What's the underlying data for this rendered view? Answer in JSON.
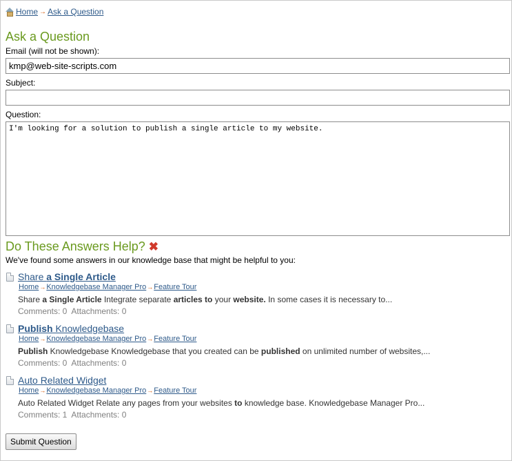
{
  "breadcrumb": {
    "items": [
      "Home",
      "Ask a Question"
    ],
    "separator": "→"
  },
  "page_title": "Ask a Question",
  "form": {
    "email_label": "Email (will not be shown):",
    "email_value": "kmp@web-site-scripts.com",
    "subject_label": "Subject:",
    "subject_value": "",
    "question_label": "Question:",
    "question_value": "I'm looking for a solution to publish a single article to my website."
  },
  "answers": {
    "title": "Do These Answers Help?",
    "intro": "We've found some answers in our knowledge base that might be helpful to you:",
    "results": [
      {
        "title_parts": [
          {
            "text": "Share ",
            "bold": false
          },
          {
            "text": "a Single Article",
            "bold": true
          }
        ],
        "crumbs": [
          "Home",
          "Knowledgebase Manager Pro",
          "Feature Tour"
        ],
        "snippet_parts": [
          {
            "text": "Share ",
            "bold": false
          },
          {
            "text": "a Single Article",
            "bold": true
          },
          {
            "text": " Integrate separate ",
            "bold": false
          },
          {
            "text": "articles to",
            "bold": true
          },
          {
            "text": " your ",
            "bold": false
          },
          {
            "text": "website.",
            "bold": true
          },
          {
            "text": " In some cases it is necessary to...",
            "bold": false
          }
        ],
        "comments": "Comments: 0",
        "attachments": "Attachments: 0"
      },
      {
        "title_parts": [
          {
            "text": "Publish",
            "bold": true
          },
          {
            "text": " Knowledgebase",
            "bold": false
          }
        ],
        "crumbs": [
          "Home",
          "Knowledgebase Manager Pro",
          "Feature Tour"
        ],
        "snippet_parts": [
          {
            "text": "Publish",
            "bold": true
          },
          {
            "text": " Knowledgebase Knowledgebase that you created can be ",
            "bold": false
          },
          {
            "text": "published",
            "bold": true
          },
          {
            "text": " on unlimited number of websites,...",
            "bold": false
          }
        ],
        "comments": "Comments: 0",
        "attachments": "Attachments: 0"
      },
      {
        "title_parts": [
          {
            "text": "Auto Related Widget",
            "bold": false
          }
        ],
        "crumbs": [
          "Home",
          "Knowledgebase Manager Pro",
          "Feature Tour"
        ],
        "snippet_parts": [
          {
            "text": "Auto Related Widget Relate any pages from your websites ",
            "bold": false
          },
          {
            "text": "to",
            "bold": true
          },
          {
            "text": " knowledge base. Knowledgebase Manager Pro...",
            "bold": false
          }
        ],
        "comments": "Comments: 1",
        "attachments": "Attachments: 0"
      }
    ]
  },
  "submit_label": "Submit Question",
  "icons": {
    "home": "home-icon",
    "close": "close-x-icon",
    "document": "document-icon"
  },
  "colors": {
    "heading": "#6a9a1f",
    "link": "#2e5a8a",
    "arrow": "#d35400",
    "close": "#d0392b"
  }
}
